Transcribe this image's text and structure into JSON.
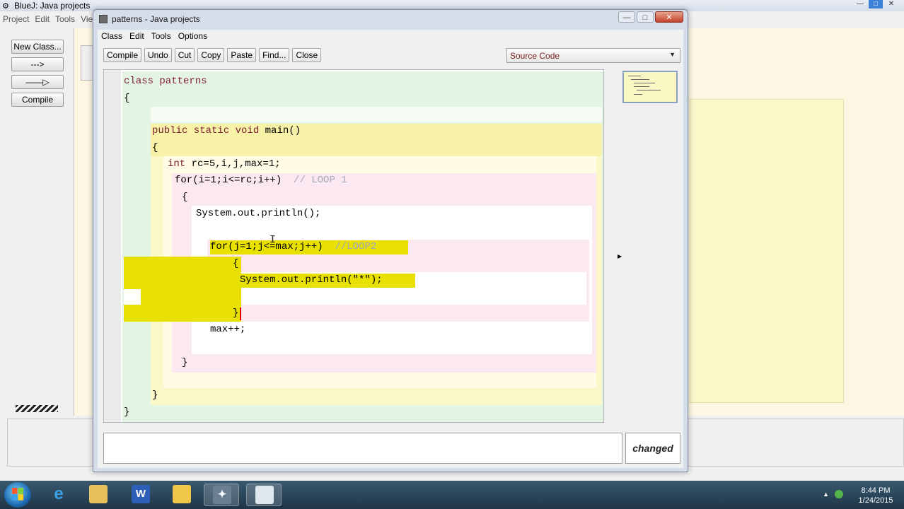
{
  "background_window": {
    "title": "BlueJ: Java projects",
    "menu": [
      "Project",
      "Edit",
      "Tools",
      "View"
    ],
    "buttons": {
      "new_class": "New Class...",
      "arrow_dashed": "--->",
      "arrow_solid": "——▷",
      "compile": "Compile"
    }
  },
  "editor": {
    "title": "patterns - Java projects",
    "menu": [
      "Class",
      "Edit",
      "Tools",
      "Options"
    ],
    "toolbar": [
      "Compile",
      "Undo",
      "Cut",
      "Copy",
      "Paste",
      "Find...",
      "Close"
    ],
    "view_select": "Source Code",
    "status": "changed",
    "code": {
      "l1": "class patterns",
      "l2": "{",
      "l3_kw": "public static void",
      "l3_rest": " main()",
      "l4": "{",
      "l5_kw": "int",
      "l5_rest": " rc=5,i,j,max=1;",
      "l6_code": "for(i=1;i<=rc;i++)",
      "l6_comment": "// LOOP 1",
      "l7": "{",
      "l8": "System.out.println();",
      "l9_code": "for(j=1;j<=max;j++)",
      "l9_comment": "//LOOP2",
      "l10": "{",
      "l11": "System.out.println(\"*\");",
      "l12": "}",
      "l13": "max++;",
      "l14": "}",
      "l15": "}",
      "l16": "}"
    }
  },
  "taskbar": {
    "time": "8:44 PM",
    "date": "1/24/2015"
  },
  "colors": {
    "class_scope": "#e4f4e4",
    "method_scope": "#fbf7c9",
    "loop_scope": "#fbe8f1",
    "inner_scope": "#ffffff",
    "selection": "#e8e000",
    "keyword": "#7b1c30"
  }
}
